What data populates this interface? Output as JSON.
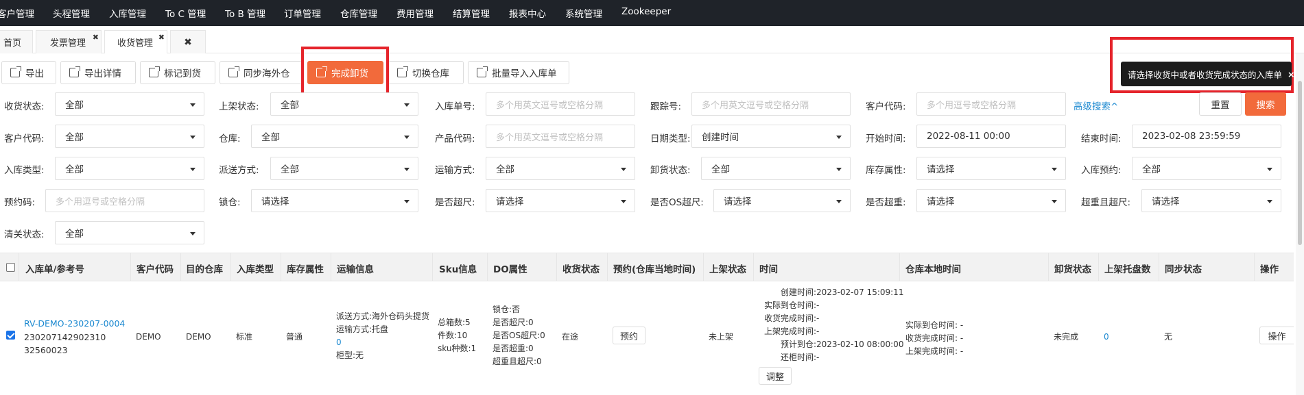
{
  "topnav": [
    "客户管理",
    "头程管理",
    "入库管理",
    "To C 管理",
    "To B 管理",
    "订单管理",
    "仓库管理",
    "费用管理",
    "结算管理",
    "报表中心",
    "系统管理",
    "Zookeeper"
  ],
  "tabs": [
    {
      "label": "首页"
    },
    {
      "label": "发票管理",
      "close": "✖"
    },
    {
      "label": "收货管理",
      "close": "✖"
    },
    {
      "label": "✖"
    }
  ],
  "toolbar": {
    "export": "导出",
    "export_detail": "导出详情",
    "mark_arrived": "标记到货",
    "sync_overseas": "同步海外仓",
    "complete_unload": "完成卸货",
    "switch_warehouse": "切换仓库",
    "batch_import": "批量导入入库单"
  },
  "toast": {
    "message": "请选择收货中或者收货完成状态的入库单",
    "close": "×"
  },
  "filters": {
    "receive_status": {
      "label": "收货状态:",
      "value": "全部"
    },
    "shelf_status": {
      "label": "上架状态:",
      "value": "全部"
    },
    "inbound_no": {
      "label": "入库单号:",
      "placeholder": "多个用英文逗号或空格分隔"
    },
    "tracking_no": {
      "label": "跟踪号:",
      "placeholder": "多个用英文逗号或空格分隔"
    },
    "customer_code_1": {
      "label": "客户代码:",
      "placeholder": "多个用逗号或空格分隔"
    },
    "advanced": "高级搜索^",
    "reset": "重置",
    "search": "搜索",
    "customer_code_2": {
      "label": "客户代码:",
      "value": "全部"
    },
    "warehouse": {
      "label": "仓库:",
      "value": "全部"
    },
    "product_code": {
      "label": "产品代码:",
      "placeholder": "多个用英文逗号或空格分隔"
    },
    "date_type": {
      "label": "日期类型:",
      "value": "创建时间"
    },
    "start_time": {
      "label": "开始时间:",
      "value": "2022-08-11 00:00"
    },
    "end_time": {
      "label": "结束时间:",
      "value": "2023-02-08 23:59:59"
    },
    "inbound_type": {
      "label": "入库类型:",
      "value": "全部"
    },
    "dispatch_method": {
      "label": "派送方式:",
      "value": "全部"
    },
    "transport_method": {
      "label": "运输方式:",
      "value": "全部"
    },
    "unload_status": {
      "label": "卸货状态:",
      "value": "全部"
    },
    "stock_attr": {
      "label": "库存属性:",
      "value": "请选择"
    },
    "inbound_booking": {
      "label": "入库预约:",
      "value": "全部"
    },
    "booking_code": {
      "label": "预约码:",
      "placeholder": "多个用逗号或空格分隔"
    },
    "lock": {
      "label": "锁仓:",
      "value": "请选择"
    },
    "oversize": {
      "label": "是否超尺:",
      "value": "请选择"
    },
    "os_oversize": {
      "label": "是否OS超尺:",
      "value": "请选择"
    },
    "overweight": {
      "label": "是否超重:",
      "value": "请选择"
    },
    "overweight_oversize": {
      "label": "超重且超尺:",
      "value": "请选择"
    },
    "customs_status": {
      "label": "清关状态:",
      "value": "全部"
    }
  },
  "table": {
    "headers": [
      "入库单/参考号",
      "客户代码",
      "目的仓库",
      "入库类型",
      "库存属性",
      "运输信息",
      "Sku信息",
      "DO属性",
      "收货状态",
      "预约(仓库当地时间)",
      "上架状态",
      "时间",
      "仓库本地时间",
      "卸货状态",
      "上架托盘数",
      "同步状态",
      "操作"
    ],
    "row": {
      "inbound_no": "RV-DEMO-230207-0004",
      "ref_line1": "230207142902310",
      "ref_line2": "32560023",
      "customer_code": "DEMO",
      "warehouse": "DEMO",
      "inbound_type": "标准",
      "stock_attr": "普通",
      "transport": [
        "派送方式:海外仓码头提货",
        "运输方式:托盘",
        "0",
        "柜型:无"
      ],
      "sku": [
        "总箱数:5",
        "件数:10",
        "sku种数:1"
      ],
      "do_attr": [
        "锁仓:否",
        "是否超尺:0",
        "是否OS超尺:0",
        "是否超重:0",
        "超重且超尺:0"
      ],
      "receive_status": "在途",
      "booking_btn": "预约",
      "shelf_status": "未上架",
      "times": [
        {
          "k": "创建时间:",
          "v": "2023-02-07 15:09:11"
        },
        {
          "k": "实际到仓时间:",
          "v": "-"
        },
        {
          "k": "收货完成时间:",
          "v": "-"
        },
        {
          "k": "上架完成时间:",
          "v": "-"
        },
        {
          "k": "预计到仓:",
          "v": "2023-02-10 08:00:00"
        },
        {
          "k": "还柜时间:",
          "v": "-"
        }
      ],
      "adjust_btn": "调整",
      "local_times": [
        "实际到仓时间: -",
        "收货完成时间: -",
        "上架完成时间: -"
      ],
      "unload_status": "未完成",
      "pallets": "0",
      "sync_status": "无",
      "action_btn": "操作"
    }
  }
}
